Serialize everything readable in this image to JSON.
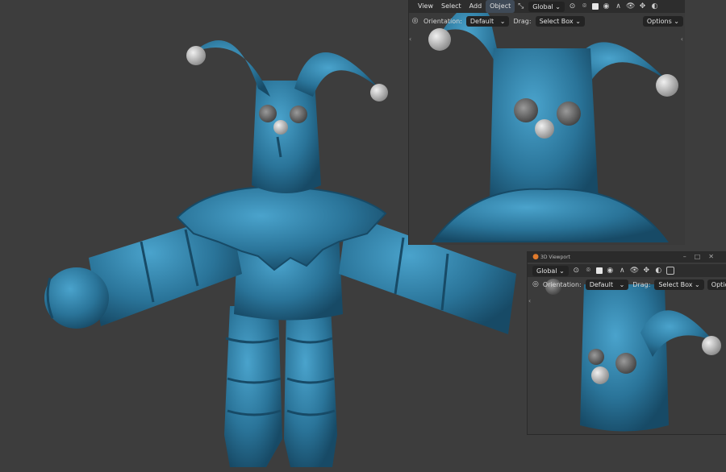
{
  "main_viewport": {
    "description_icons": []
  },
  "viewport1": {
    "menu": [
      "View",
      "Select",
      "Add",
      "Object"
    ],
    "active_menu": "Object",
    "transform_orientation": "Global",
    "orientation_label": "Orientation:",
    "orientation_value": "Default",
    "drag_label": "Drag:",
    "drag_value": "Select Box",
    "options_label": "Options"
  },
  "viewport2": {
    "window_title": "3D Viewport",
    "transform_orientation": "Global",
    "orientation_label": "Orientation:",
    "orientation_value": "Default",
    "drag_label": "Drag:",
    "drag_value": "Select Box",
    "options_label": "Optic"
  },
  "colors": {
    "body": "#2a6f93",
    "body_light": "#3a8fb8",
    "ball": "#c8c8c8",
    "background": "#3d3d3d"
  }
}
